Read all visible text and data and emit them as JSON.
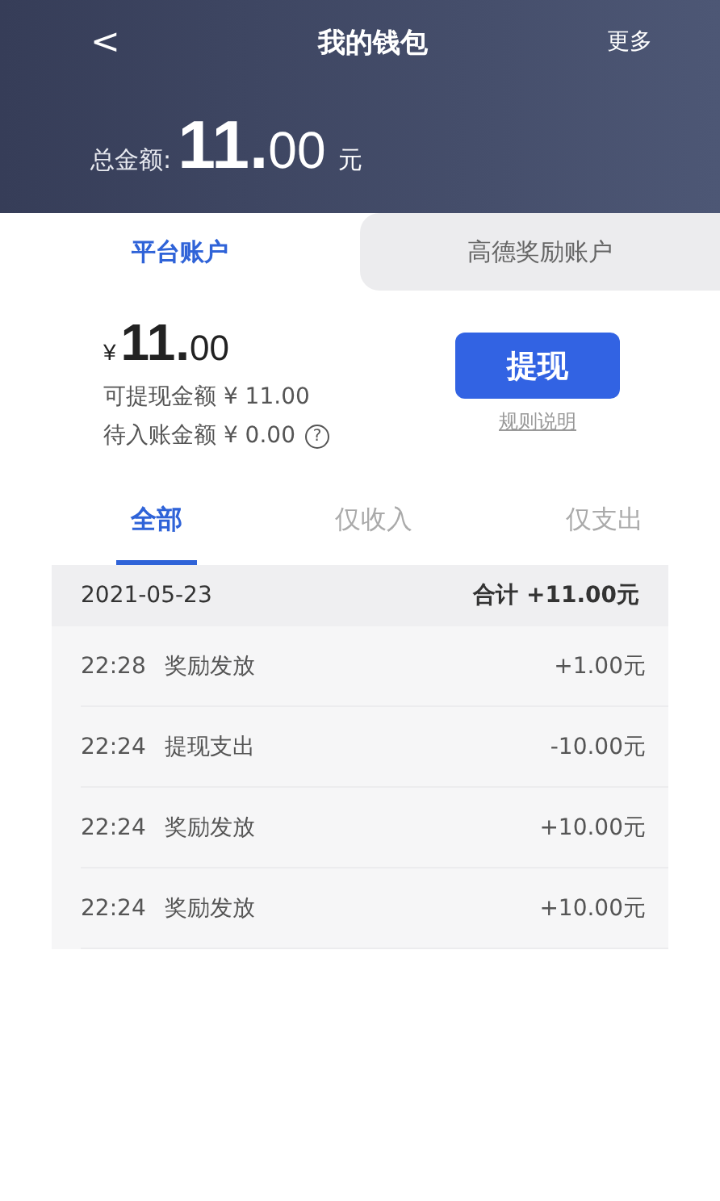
{
  "header": {
    "back": "<",
    "title": "我的钱包",
    "more": "更多"
  },
  "total": {
    "label": "总金额:",
    "integer": "11.",
    "decimal": "00",
    "unit": "元"
  },
  "account_tabs": [
    {
      "label": "平台账户",
      "selected": true
    },
    {
      "label": "高德奖励账户",
      "selected": false
    }
  ],
  "balance": {
    "currency": "¥",
    "integer": "11.",
    "decimal": "00",
    "withdrawable": "可提现金额 ¥ 11.00",
    "pending": "待入账金额 ¥ 0.00",
    "help": "?",
    "button": "提现",
    "rules_link": "规则说明"
  },
  "filter_tabs": [
    {
      "label": "全部",
      "selected": true
    },
    {
      "label": "仅收入",
      "selected": false
    },
    {
      "label": "仅支出",
      "selected": false
    }
  ],
  "day": {
    "date": "2021-05-23",
    "total": "合计 +11.00元"
  },
  "records": [
    {
      "time": "22:28",
      "title": "奖励发放",
      "amount": "+1.00元"
    },
    {
      "time": "22:24",
      "title": "提现支出",
      "amount": "-10.00元"
    },
    {
      "time": "22:24",
      "title": "奖励发放",
      "amount": "+10.00元"
    },
    {
      "time": "22:24",
      "title": "奖励发放",
      "amount": "+10.00元"
    }
  ]
}
